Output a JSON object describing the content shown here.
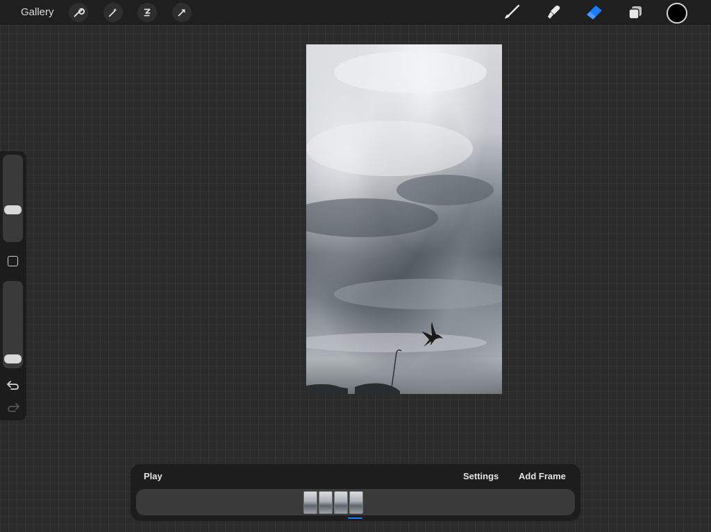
{
  "topbar": {
    "gallery_label": "Gallery",
    "left_tools": [
      {
        "icon": "wrench-icon",
        "name": "Actions"
      },
      {
        "icon": "magic-wand-icon",
        "name": "Adjustments"
      },
      {
        "icon": "selection-icon",
        "name": "Selection"
      },
      {
        "icon": "transform-arrow-icon",
        "name": "Transform"
      }
    ],
    "right_tools": [
      {
        "icon": "brush-icon",
        "name": "Paint"
      },
      {
        "icon": "smudge-icon",
        "name": "Smudge"
      },
      {
        "icon": "eraser-icon",
        "name": "Erase",
        "active": true
      },
      {
        "icon": "layers-icon",
        "name": "Layers"
      }
    ],
    "active_color": "#000000",
    "active_tool_color": "#1b7cff"
  },
  "sidebar": {
    "brush_size_level": 0.35,
    "opacity_level": 0.05
  },
  "timeline": {
    "play_label": "Play",
    "settings_label": "Settings",
    "add_frame_label": "Add Frame",
    "frame_count": 4,
    "selected_frame": 4
  }
}
